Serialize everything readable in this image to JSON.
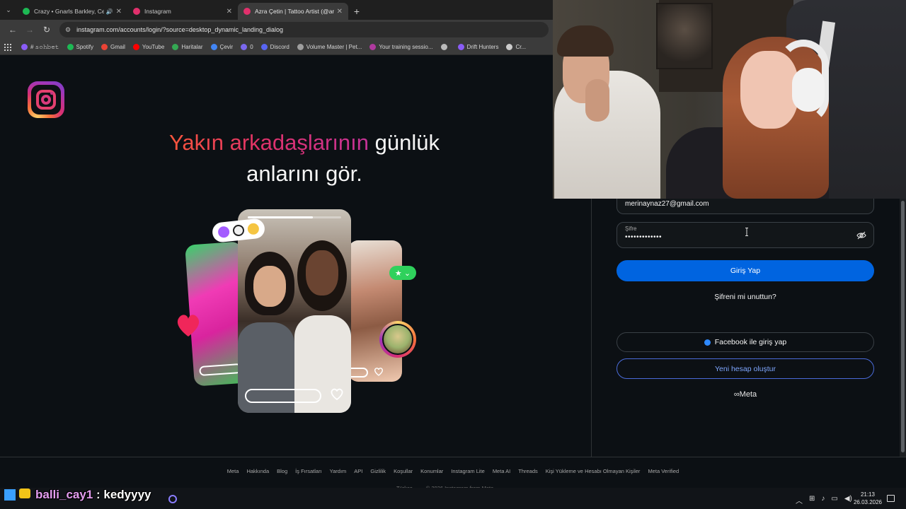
{
  "browser": {
    "tabs": [
      {
        "label": "Crazy • Gnarls Barkley, Cee",
        "favicon_color": "#1db954",
        "audio": "🔊"
      },
      {
        "label": "Instagram",
        "favicon_color": "#e1306c"
      },
      {
        "label": "Azra Çetin | Tattoo Artist (@arti",
        "favicon_color": "#e1306c",
        "active": true
      }
    ],
    "url": "instagram.com/accounts/login/?source=desktop_dynamic_landing_dialog",
    "bookmarks": [
      {
        "label": "# 𝚜𝚘𝚑𝚋𝚎𝚝",
        "color": "#8a5cf6"
      },
      {
        "label": "Spotify",
        "color": "#1db954"
      },
      {
        "label": "Gmail",
        "color": "#ea4335"
      },
      {
        "label": "YouTube",
        "color": "#ff0000"
      },
      {
        "label": "Haritalar",
        "color": "#34a853"
      },
      {
        "label": "Çevir",
        "color": "#4285f4"
      },
      {
        "label": "0",
        "color": "#7b68ee"
      },
      {
        "label": "Discord",
        "color": "#5865f2"
      },
      {
        "label": "Volume Master | Pet...",
        "color": "#9e9e9e"
      },
      {
        "label": "Your training sessio...",
        "color": "#b03a9f"
      },
      {
        "label": "",
        "color": "#bbbbbb"
      },
      {
        "label": "Drift Hunters",
        "color": "#8a5cf6"
      },
      {
        "label": "Cr...",
        "color": "#cccccc"
      }
    ]
  },
  "landing": {
    "headline_part1": "Yakın arkadaşlarının",
    "headline_part2": " günlük",
    "headline_part3": "anlarını gör."
  },
  "login": {
    "email_value": "merinaynaz27@gmail.com",
    "password_label": "Şifre",
    "password_value": "•••••••••••••",
    "login_button": "Giriş Yap",
    "forgot_link": "Şifreni mi unuttun?",
    "facebook_button": "Facebook ile giriş yap",
    "signup_button": "Yeni hesap oluştur",
    "meta_brand": "∞Meta"
  },
  "footer": {
    "links": [
      "Meta",
      "Hakkında",
      "Blog",
      "İş Fırsatları",
      "Yardım",
      "API",
      "Gizlilik",
      "Koşullar",
      "Konumlar",
      "Instagram Lite",
      "Meta AI",
      "Threads",
      "Kişi Yükleme ve Hesabı Olmayan Kişiler",
      "Meta Verified"
    ],
    "language": "Türkçe ⌄",
    "copyright": "© 2026 Instagram from Meta"
  },
  "taskbar": {
    "chat_user": "balli_cay1",
    "chat_sep": " : ",
    "chat_message": "kedyyyy",
    "time": "21:13",
    "date": "26.03.2026"
  }
}
